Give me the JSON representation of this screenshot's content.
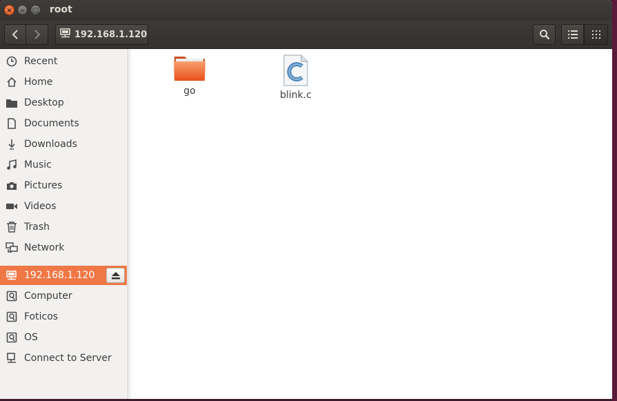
{
  "window": {
    "title": "root",
    "controls": {
      "close": "×",
      "minimize": "–",
      "maximize": "□"
    }
  },
  "toolbar": {
    "path_label": "192.168.1.120"
  },
  "sidebar": {
    "items": [
      {
        "label": "Recent",
        "icon": "clock-icon"
      },
      {
        "label": "Home",
        "icon": "home-icon"
      },
      {
        "label": "Desktop",
        "icon": "folder-icon"
      },
      {
        "label": "Documents",
        "icon": "document-icon"
      },
      {
        "label": "Downloads",
        "icon": "download-icon"
      },
      {
        "label": "Music",
        "icon": "music-icon"
      },
      {
        "label": "Pictures",
        "icon": "camera-icon"
      },
      {
        "label": "Videos",
        "icon": "video-icon"
      },
      {
        "label": "Trash",
        "icon": "trash-icon"
      },
      {
        "label": "Network",
        "icon": "network-icon"
      }
    ],
    "devices": [
      {
        "label": "192.168.1.120",
        "icon": "network-drive-icon",
        "active": true
      },
      {
        "label": "Computer",
        "icon": "drive-icon"
      },
      {
        "label": "Foticos",
        "icon": "drive-icon"
      },
      {
        "label": "OS",
        "icon": "drive-icon"
      },
      {
        "label": "Connect to Server",
        "icon": "server-icon"
      }
    ]
  },
  "files": [
    {
      "name": "go",
      "type": "folder"
    },
    {
      "name": "blink.c",
      "type": "c-source"
    }
  ],
  "colors": {
    "accent": "#f07746",
    "titlebar": "#3c3b37",
    "folder": "#f06a2e"
  }
}
